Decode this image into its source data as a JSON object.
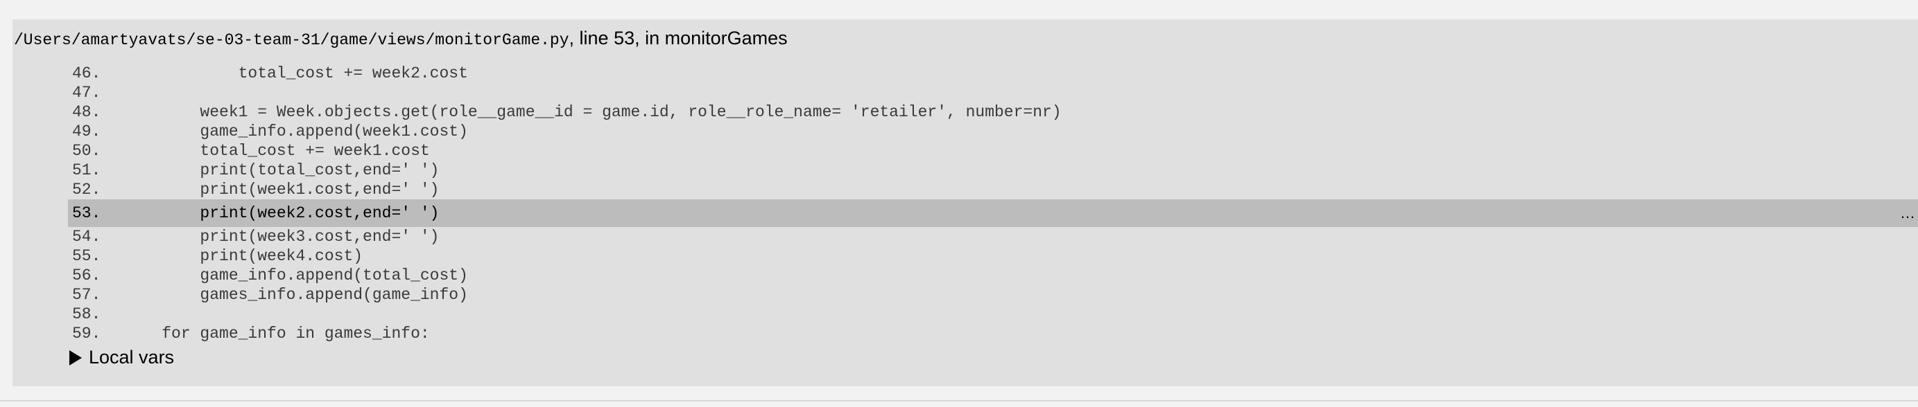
{
  "frame": {
    "filename": "/Users/amartyavats/se-03-team-31/game/views/monitorGame.py",
    "suffix": ", line 53, in monitorGames",
    "pre_context": [
      {
        "lineno": "46.",
        "code": "            total_cost += week2.cost"
      },
      {
        "lineno": "47.",
        "code": ""
      },
      {
        "lineno": "48.",
        "code": "        week1 = Week.objects.get(role__game__id = game.id, role__role_name= 'retailer', number=nr)"
      },
      {
        "lineno": "49.",
        "code": "        game_info.append(week1.cost)"
      },
      {
        "lineno": "50.",
        "code": "        total_cost += week1.cost"
      },
      {
        "lineno": "51.",
        "code": "        print(total_cost,end=' ')"
      },
      {
        "lineno": "52.",
        "code": "        print(week1.cost,end=' ')"
      }
    ],
    "context_line": {
      "lineno": "53.",
      "code": "        print(week2.cost,end=' ')",
      "ellipsis": "…"
    },
    "post_context": [
      {
        "lineno": "54.",
        "code": "        print(week3.cost,end=' ')"
      },
      {
        "lineno": "55.",
        "code": "        print(week4.cost)"
      },
      {
        "lineno": "56.",
        "code": "        game_info.append(total_cost)"
      },
      {
        "lineno": "57.",
        "code": "        games_info.append(game_info)"
      },
      {
        "lineno": "58.",
        "code": ""
      },
      {
        "lineno": "59.",
        "code": "    for game_info in games_info:"
      }
    ],
    "locals_label": "Local vars"
  },
  "colors": {
    "page_background": "#f2f2f2",
    "frame_background": "#e0e0e0",
    "current_line_background": "#bcbcbc",
    "code_text": "#3a3a3a"
  }
}
